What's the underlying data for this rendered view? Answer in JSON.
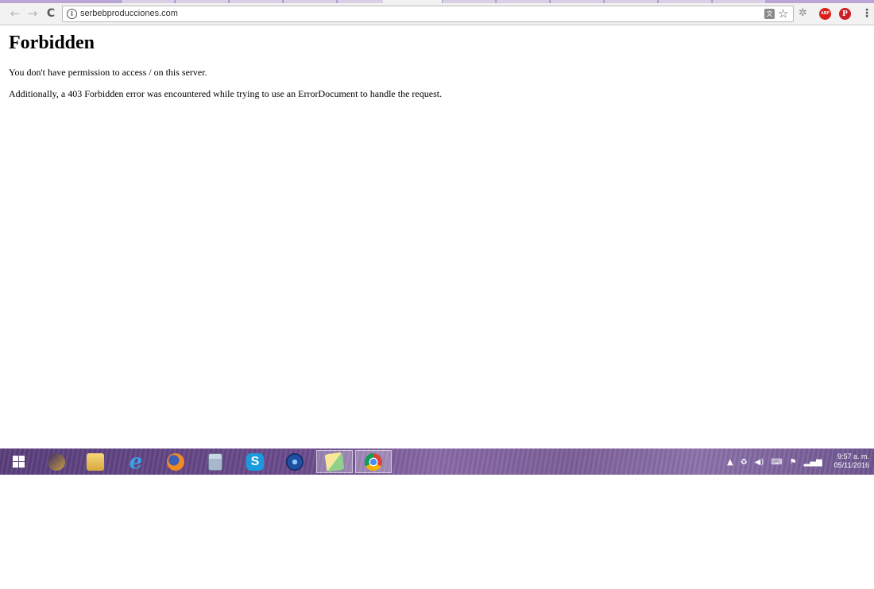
{
  "browser": {
    "url": "serbebproducciones.com"
  },
  "page": {
    "title": "Forbidden",
    "paragraphs": [
      "You don't have permission to access / on this server.",
      "Additionally, a 403 Forbidden error was encountered while trying to use an ErrorDocument to handle the request."
    ]
  },
  "extensions": {
    "abp_label": "ABP",
    "pinterest_label": "P"
  },
  "taskbar": {
    "apps": [
      "start",
      "itunes",
      "file-explorer",
      "internet-explorer",
      "firefox",
      "calculator",
      "skype",
      "network-app",
      "sticky-notes",
      "chrome"
    ],
    "active_app": "chrome",
    "tray_icons": [
      "show-hidden-icons",
      "network-share",
      "volume",
      "language-input",
      "action-center-flag",
      "signal"
    ],
    "clock_time": "9:57 a. m.",
    "clock_date": "05/11/2016"
  },
  "colors": {
    "taskbar": "#6b4c8d",
    "abp": "#d9201a",
    "pinterest": "#cc1f27"
  }
}
